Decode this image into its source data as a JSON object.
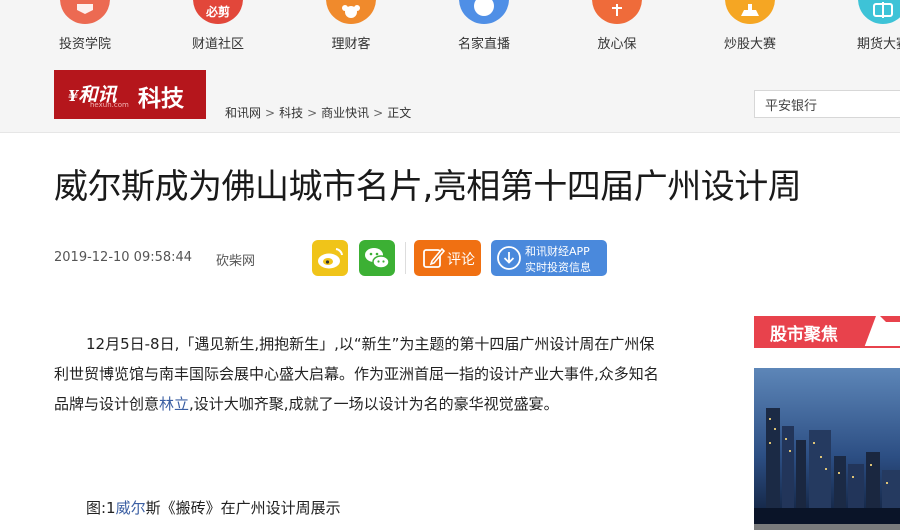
{
  "nav": {
    "items": [
      {
        "label": "投资学院",
        "icon": "academy-icon",
        "color": "#ec6a52"
      },
      {
        "label": "财道社区",
        "icon": "community-icon",
        "color": "#e2473a",
        "glyph": "必剪"
      },
      {
        "label": "理财客",
        "icon": "wealth-icon",
        "color": "#f08a2c"
      },
      {
        "label": "名家直播",
        "icon": "live-icon",
        "color": "#4f8fe6"
      },
      {
        "label": "放心保",
        "icon": "insurance-icon",
        "color": "#ef6b3a"
      },
      {
        "label": "炒股大赛",
        "icon": "contest-icon",
        "color": "#f5a623"
      },
      {
        "label": "期货大赛",
        "icon": "futures-icon",
        "color": "#3ec3d7"
      }
    ]
  },
  "header": {
    "logo_brand": "和讯",
    "logo_domain": "hexun.com",
    "logo_channel": "科技",
    "breadcrumb": [
      "和讯网",
      "科技",
      "商业快讯",
      "正文"
    ],
    "search_value": "平安银行"
  },
  "article": {
    "title": "威尔斯成为佛山城市名片,亮相第十四届广州设计周",
    "date": "2019-12-10 09:58:44",
    "source": "砍柴网",
    "comment_label": "评论",
    "app_line1": "和讯财经APP",
    "app_line2": "实时投资信息",
    "paragraph_pre": "12月5日-8日,「遇见新生,拥抱新生」,以“新生”为主题的第十四届广州设计周在广州保利世贸博览馆与南丰国际会展中心盛大启幕。作为亚洲首屈一指的设计产业大事件,众多知名品牌与设计创意",
    "paragraph_link": "林立",
    "paragraph_post": ",设计大咖齐聚,成就了一场以设计为名的豪华视觉盛宴。",
    "caption_pre": "图:1",
    "caption_link": "威尔",
    "caption_post": "斯《搬砖》在广州设计周展示"
  },
  "sidebar": {
    "title": "股市聚焦"
  },
  "colors": {
    "brand_red": "#b5161c",
    "sidebar_red": "#e8424c",
    "link_blue": "#3b5fa3"
  }
}
